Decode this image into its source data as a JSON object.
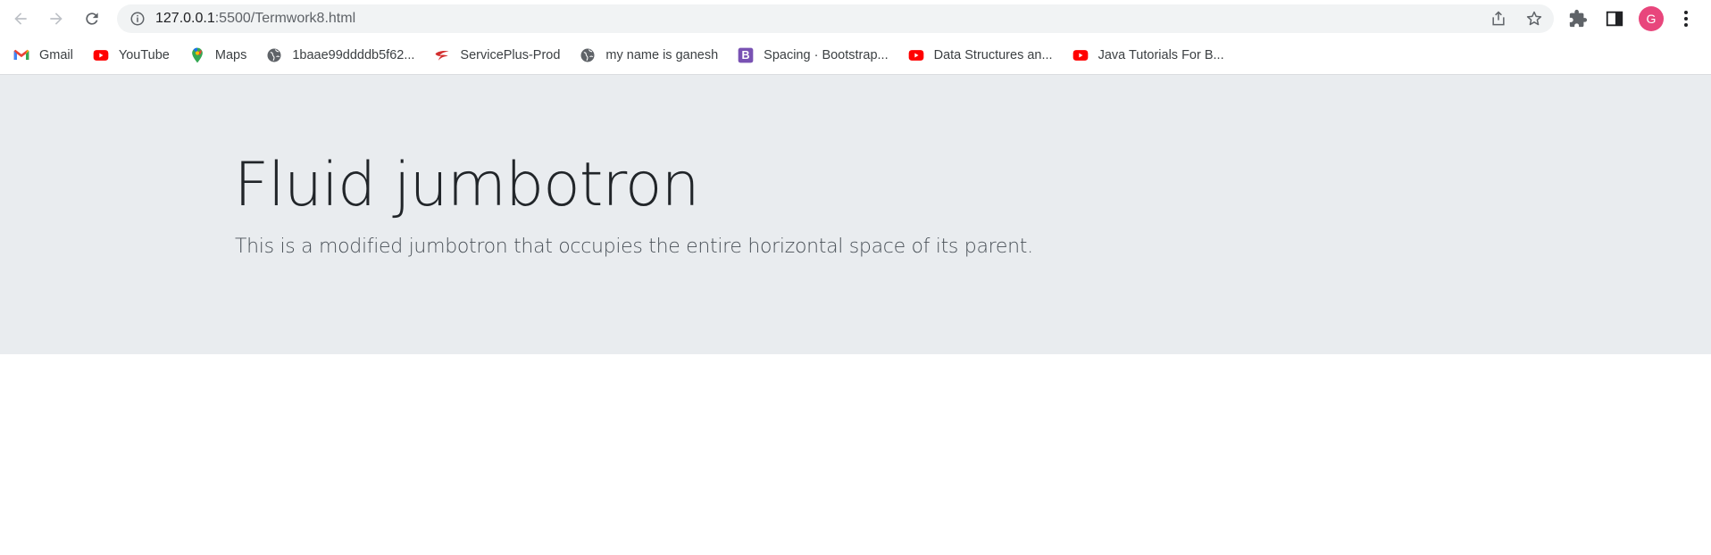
{
  "browser": {
    "url_host": "127.0.0.1",
    "url_path": ":5500/Termwork8.html",
    "profile_initial": "G",
    "profile_color": "#e8467c"
  },
  "bookmarks": [
    {
      "label": "Gmail",
      "icon": "gmail-icon"
    },
    {
      "label": "YouTube",
      "icon": "youtube-icon"
    },
    {
      "label": "Maps",
      "icon": "maps-icon"
    },
    {
      "label": "1baae99ddddb5f62...",
      "icon": "globe-icon"
    },
    {
      "label": "ServicePlus-Prod",
      "icon": "serviceplus-icon"
    },
    {
      "label": "my name is ganesh",
      "icon": "globe-icon"
    },
    {
      "label": "Spacing · Bootstrap...",
      "icon": "bootstrap-icon"
    },
    {
      "label": "Data Structures an...",
      "icon": "youtube-icon"
    },
    {
      "label": "Java Tutorials For B...",
      "icon": "youtube-icon"
    }
  ],
  "jumbotron": {
    "title": "Fluid jumbotron",
    "lead": "This is a modified jumbotron that occupies the entire horizontal space of its parent.",
    "background": "#e9ecef"
  }
}
